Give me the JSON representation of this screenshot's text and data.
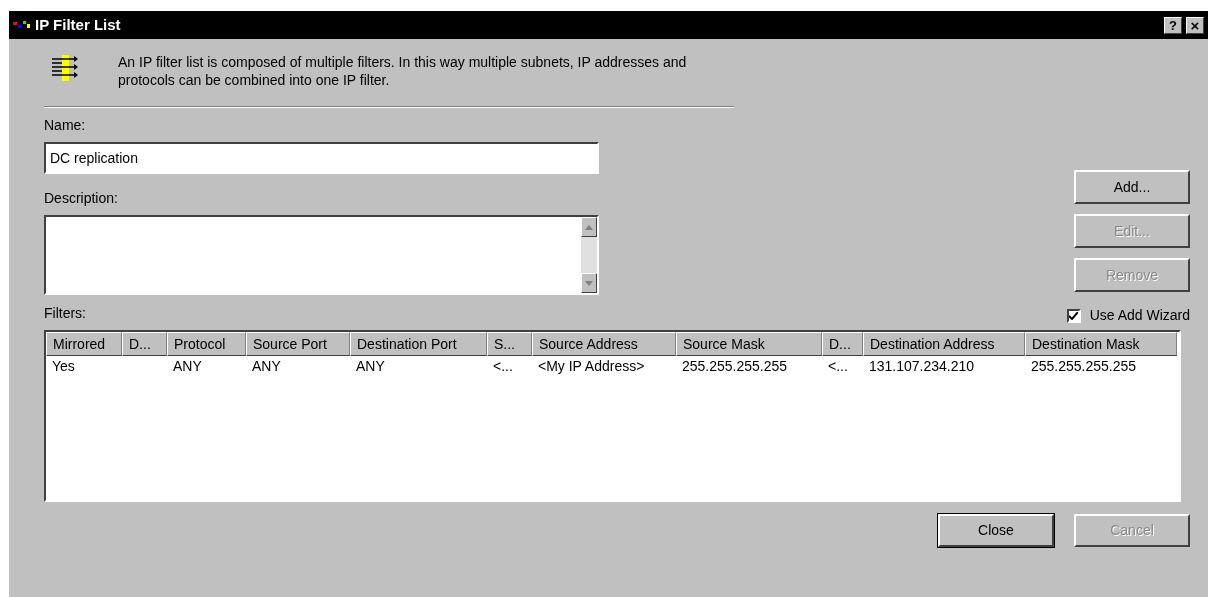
{
  "window": {
    "title": "IP Filter List",
    "help_button": "?",
    "close_button": "×"
  },
  "intro": "An IP filter list is composed of multiple filters. In this way multiple subnets, IP addresses and protocols can be combined into one IP filter.",
  "name": {
    "label": "Name:",
    "value": "DC replication"
  },
  "description": {
    "label": "Description:"
  },
  "side_buttons": [
    {
      "label": "Add...",
      "disabled": false
    },
    {
      "label": "Edit...",
      "disabled": true
    },
    {
      "label": "Remove",
      "disabled": true
    }
  ],
  "use_add_wizard": {
    "label": "Use Add Wizard",
    "checked": true
  },
  "filters": {
    "label": "Filters:",
    "columns": [
      "Mirrored",
      "D...",
      "Protocol",
      "Source Port",
      "Destination Port",
      "S...",
      "Source Address",
      "Source Mask",
      "D...",
      "Destination Address",
      "Destination Mask"
    ],
    "rows": [
      [
        "Yes",
        "",
        "ANY",
        "ANY",
        "ANY",
        "<...",
        "<My IP Address>",
        "255.255.255.255",
        "<...",
        "131.107.234.210",
        "255.255.255.255"
      ]
    ]
  },
  "footer_buttons": [
    {
      "label": "Close",
      "disabled": false,
      "default": true
    },
    {
      "label": "Cancel",
      "disabled": true,
      "default": false
    }
  ]
}
